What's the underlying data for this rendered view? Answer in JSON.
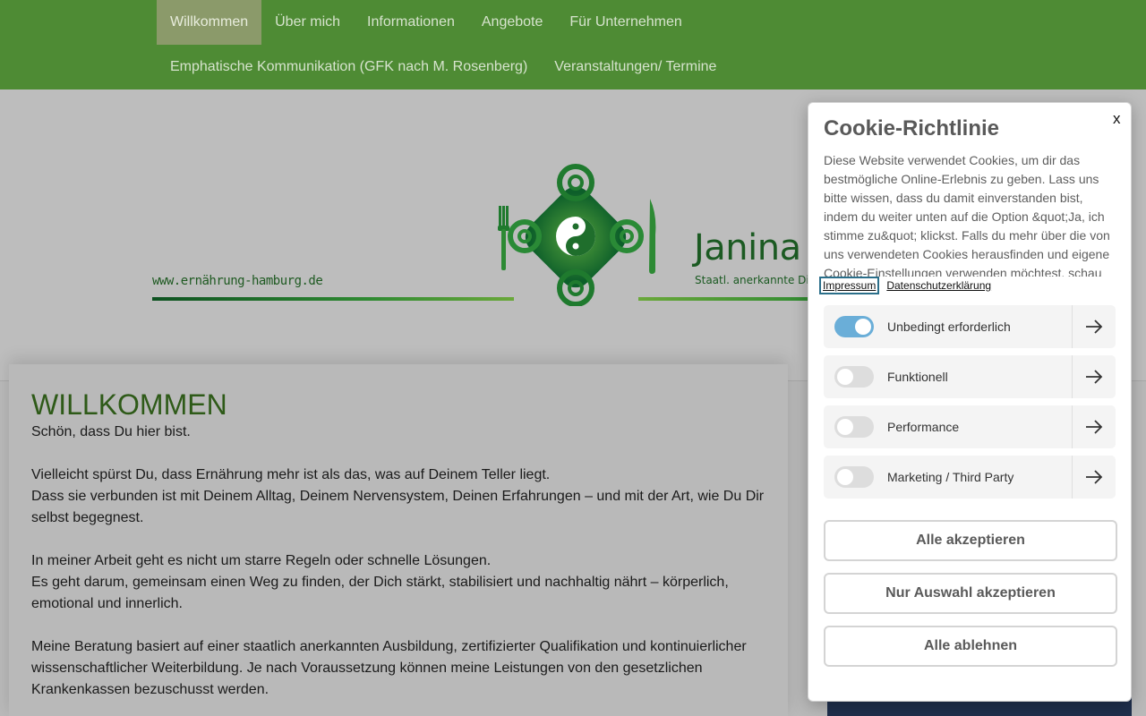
{
  "nav": {
    "row1": [
      "Willkommen",
      "Über mich",
      "Informationen",
      "Angebote",
      "Für Unternehmen"
    ],
    "row2": [
      "Emphatische Kommunikation (GFK nach M. Rosenberg)",
      "Veranstaltungen/ Termine"
    ],
    "active": "Willkommen"
  },
  "header": {
    "url": "www.ernährung-hamburg.de",
    "name": "Janina G",
    "subtitle": "Staatl. anerkannte Diä"
  },
  "main": {
    "title": "WILLKOMMEN",
    "paragraphs": [
      "Schön, dass Du hier bist.",
      "Vielleicht spürst Du, dass Ernährung mehr ist als das, was auf Deinem Teller liegt.\nDass sie verbunden ist mit Deinem Alltag, Deinem Nervensystem, Deinen Erfahrungen – und mit der Art, wie Du Dir selbst begegnest.",
      "In meiner Arbeit geht es nicht um starre Regeln oder schnelle Lösungen.\nEs geht darum, gemeinsam einen Weg zu finden, der Dich stärkt, stabilisiert und nachhaltig nährt – körperlich, emotional und innerlich.",
      "Meine Beratung basiert auf einer staatlich anerkannten Ausbildung, zertifizierter Qualifikation und kontinuierlicher wissenschaftlicher Weiterbildung. Je nach Voraussetzung können meine Leistungen von den gesetzlichen Krankenkassen bezuschusst werden."
    ]
  },
  "cookie": {
    "close": "x",
    "title": "Cookie-Richtlinie",
    "text": "Diese Website verwendet Cookies, um dir das bestmögliche Online-Erlebnis zu geben. Lass uns bitte wissen, dass du damit einverstanden bist, indem du weiter unten auf die Option &quot;Ja, ich stimme zu&quot; klickst. Falls du mehr über die von uns verwendeten Cookies herausfinden und eigene Cookie-Einstellungen verwenden möchtest, schau",
    "links": {
      "impressum": "Impressum",
      "privacy": "Datenschutzerklärung"
    },
    "categories": [
      {
        "label": "Unbedingt erforderlich",
        "enabled": true
      },
      {
        "label": "Funktionell",
        "enabled": false
      },
      {
        "label": "Performance",
        "enabled": false
      },
      {
        "label": "Marketing / Third Party",
        "enabled": false
      }
    ],
    "buttons": {
      "accept_all": "Alle akzeptieren",
      "accept_selection": "Nur Auswahl akzeptieren",
      "reject_all": "Alle ablehnen"
    }
  },
  "colors": {
    "nav_bg": "#4e8b34",
    "brand_green": "#1b5a22",
    "heading_green": "#2e5a18",
    "toggle_on": "#6aaed8"
  }
}
